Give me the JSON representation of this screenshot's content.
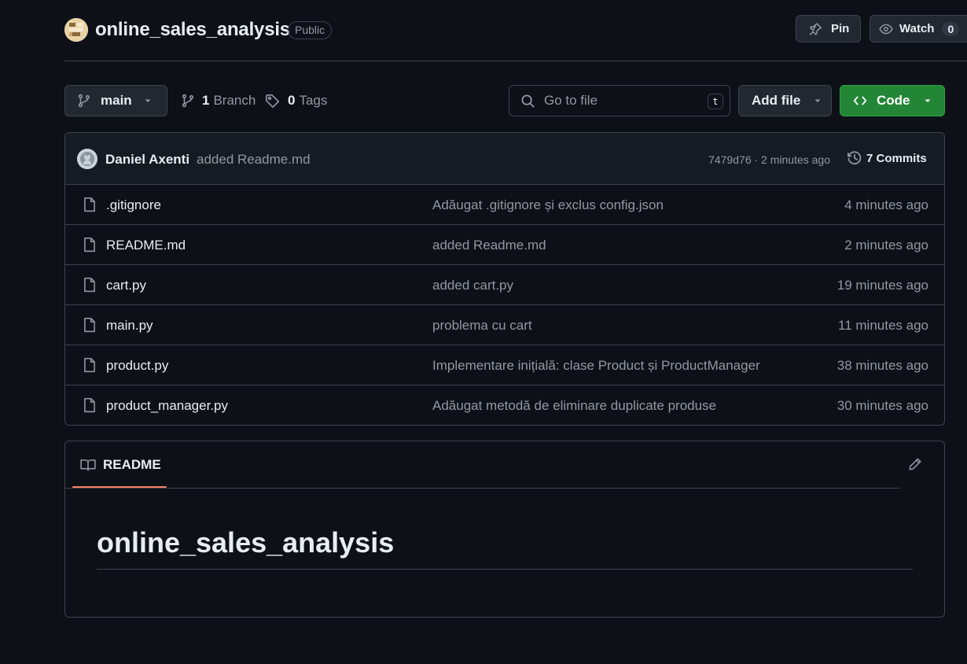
{
  "repo": {
    "name": "online_sales_analysis",
    "visibility": "Public",
    "pin_label": "Pin",
    "watch_label": "Watch",
    "watch_count": "0"
  },
  "toolbar": {
    "branch": "main",
    "branch_count": "1",
    "branch_label": "Branch",
    "tag_count": "0",
    "tag_label": "Tags",
    "search_placeholder": "Go to file",
    "search_shortcut": "t",
    "add_file_label": "Add file",
    "code_label": "Code"
  },
  "latest_commit": {
    "author": "Daniel Axenti",
    "message": "added Readme.md",
    "hash_time": "7479d76 · 2 minutes ago",
    "commits_label": "7 Commits"
  },
  "files": [
    {
      "name": ".gitignore",
      "message": "Adăugat .gitignore și exclus config.json",
      "time": "4 minutes ago"
    },
    {
      "name": "README.md",
      "message": "added Readme.md",
      "time": "2 minutes ago"
    },
    {
      "name": "cart.py",
      "message": "added cart.py",
      "time": "19 minutes ago"
    },
    {
      "name": "main.py",
      "message": "problema cu cart",
      "time": "11 minutes ago"
    },
    {
      "name": "product.py",
      "message": "Implementare inițială: clase Product și ProductManager",
      "time": "38 minutes ago"
    },
    {
      "name": "product_manager.py",
      "message": "Adăugat metodă de eliminare duplicate produse",
      "time": "30 minutes ago"
    }
  ],
  "readme": {
    "tab_label": "README",
    "title": "online_sales_analysis"
  },
  "colors": {
    "background": "#0d1117",
    "border": "#3d444d",
    "code_button": "#238636",
    "tab_accent": "#f78166"
  }
}
